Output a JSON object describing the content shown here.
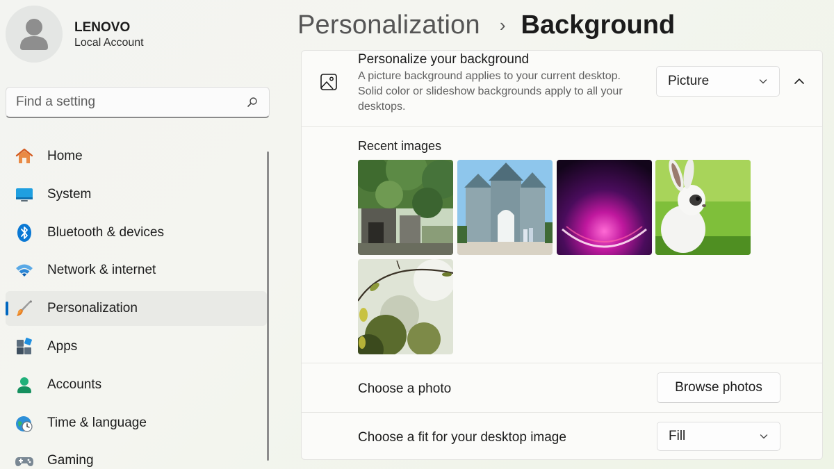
{
  "user": {
    "name": "LENOVO",
    "account_type": "Local Account"
  },
  "search": {
    "placeholder": "Find a setting"
  },
  "sidebar": {
    "items": [
      {
        "label": "Home",
        "icon": "home-icon"
      },
      {
        "label": "System",
        "icon": "system-icon"
      },
      {
        "label": "Bluetooth & devices",
        "icon": "bluetooth-icon"
      },
      {
        "label": "Network & internet",
        "icon": "wifi-icon"
      },
      {
        "label": "Personalization",
        "icon": "brush-icon",
        "active": true
      },
      {
        "label": "Apps",
        "icon": "apps-icon"
      },
      {
        "label": "Accounts",
        "icon": "accounts-icon"
      },
      {
        "label": "Time & language",
        "icon": "clock-globe-icon"
      },
      {
        "label": "Gaming",
        "icon": "gamepad-icon"
      }
    ]
  },
  "header": {
    "parent": "Personalization",
    "separator": "›",
    "current": "Background"
  },
  "background": {
    "title": "Personalize your background",
    "description": "A picture background applies to your current desktop. Solid color or slideshow backgrounds apply to all your desktops.",
    "type_value": "Picture",
    "recent_label": "Recent images",
    "choose_photo_label": "Choose a photo",
    "browse_label": "Browse photos",
    "fit_label": "Choose a fit for your desktop image",
    "fit_value": "Fill"
  },
  "colors": {
    "accent": "#0067c0",
    "active_nav_bg": "#e9eae6"
  }
}
